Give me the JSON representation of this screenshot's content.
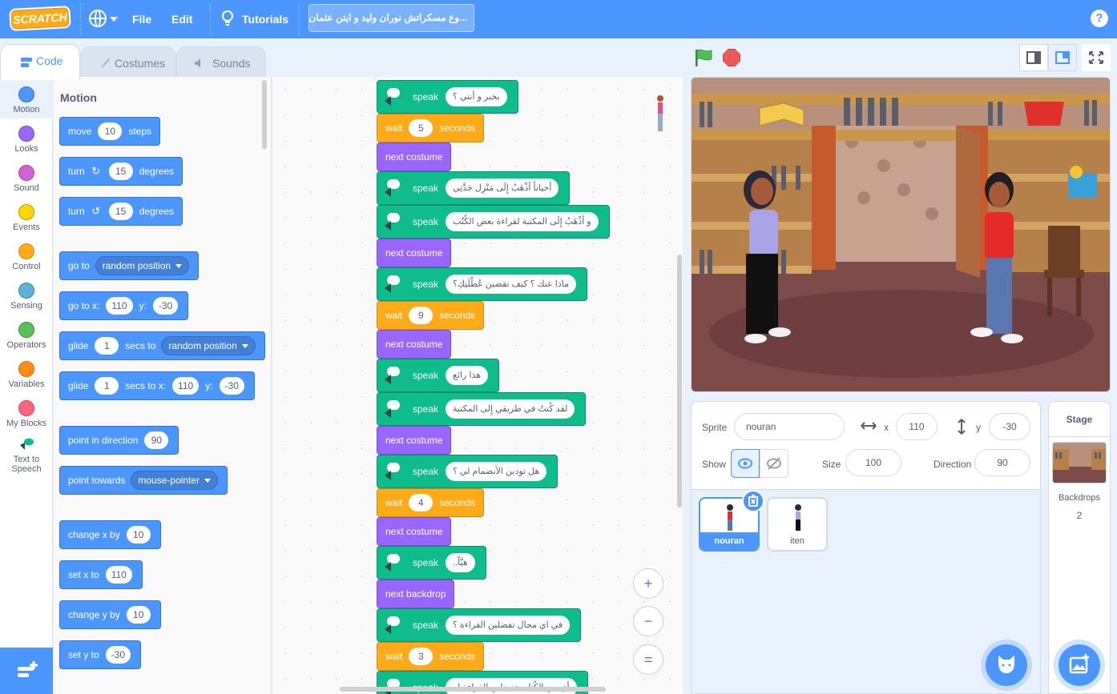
{
  "menubar": {
    "logo": "SCRATCH",
    "file": "File",
    "edit": "Edit",
    "tutorials": "Tutorials",
    "project_title": "...وع مسكراتش نوران وليد و ايتن عثمان",
    "help": "?"
  },
  "tabs": {
    "code": "Code",
    "costumes": "Costumes",
    "sounds": "Sounds"
  },
  "categories": [
    {
      "label": "Motion",
      "color": "#4c97ff"
    },
    {
      "label": "Looks",
      "color": "#9966ff"
    },
    {
      "label": "Sound",
      "color": "#cf63cf"
    },
    {
      "label": "Events",
      "color": "#ffd500"
    },
    {
      "label": "Control",
      "color": "#ffab19"
    },
    {
      "label": "Sensing",
      "color": "#5cb1d6"
    },
    {
      "label": "Operators",
      "color": "#59c059"
    },
    {
      "label": "Variables",
      "color": "#ff8c1a"
    },
    {
      "label": "My Blocks",
      "color": "#ff6680"
    },
    {
      "label": "Text to Speech",
      "color": "#0fbd8c"
    }
  ],
  "palette": {
    "title": "Motion",
    "move": {
      "a": "move",
      "v": "10",
      "b": "steps"
    },
    "turn_cw": {
      "a": "turn",
      "v": "15",
      "b": "degrees"
    },
    "turn_ccw": {
      "a": "turn",
      "v": "15",
      "b": "degrees"
    },
    "goto": {
      "a": "go to",
      "opt": "random position"
    },
    "goto_xy": {
      "a": "go to x:",
      "x": "110",
      "b": "y:",
      "y": "-30"
    },
    "glide": {
      "a": "glide",
      "v": "1",
      "b": "secs to",
      "opt": "random position"
    },
    "glide_xy": {
      "a": "glide",
      "v": "1",
      "b": "secs to x:",
      "x": "110",
      "c": "y:",
      "y": "-30"
    },
    "point_dir": {
      "a": "point in direction",
      "v": "90"
    },
    "point_towards": {
      "a": "point towards",
      "opt": "mouse-pointer"
    },
    "change_x": {
      "a": "change x by",
      "v": "10"
    },
    "set_x": {
      "a": "set x to",
      "v": "110"
    },
    "change_y": {
      "a": "change y by",
      "v": "10"
    },
    "set_y": {
      "a": "set y to",
      "v": "-30"
    }
  },
  "script": [
    {
      "type": "speak",
      "label": "speak",
      "text": "بخير و أنتي ؟"
    },
    {
      "type": "wait",
      "label": "wait",
      "value": "5",
      "suffix": "seconds"
    },
    {
      "type": "costume",
      "label": "next costume"
    },
    {
      "type": "speak",
      "label": "speak",
      "text": "أحياناً أذْهَبُ إِلَى مَنْزِل جَدَّتِي"
    },
    {
      "type": "speak",
      "label": "speak",
      "text": "و أذْهَبُ إِلَى المكتبة لقراءة بعض الكُتُب"
    },
    {
      "type": "costume",
      "label": "next costume"
    },
    {
      "type": "speak",
      "label": "speak",
      "text": "ماذا عنك ؟ كيف تقضين عُطْلَتِكِ؟"
    },
    {
      "type": "wait",
      "label": "wait",
      "value": "9",
      "suffix": "seconds"
    },
    {
      "type": "costume",
      "label": "next costume"
    },
    {
      "type": "speak",
      "label": "speak",
      "text": "هذا رائع"
    },
    {
      "type": "speak",
      "label": "speak",
      "text": "لقد كُنتُ في طريقي إِلى المكتبة"
    },
    {
      "type": "costume",
      "label": "next costume"
    },
    {
      "type": "speak",
      "label": "speak",
      "text": "هل تودين الأنضمام لي ؟"
    },
    {
      "type": "wait",
      "label": "wait",
      "value": "4",
      "suffix": "seconds"
    },
    {
      "type": "costume",
      "label": "next costume"
    },
    {
      "type": "speak",
      "label": "speak",
      "text": "هيَّاً.."
    },
    {
      "type": "backdrop",
      "label": "next backdrop"
    },
    {
      "type": "speak",
      "label": "speak",
      "text": "في اي مجال تفضلين القراءة ؟"
    },
    {
      "type": "wait",
      "label": "wait",
      "value": "3",
      "suffix": "seconds"
    },
    {
      "type": "speak",
      "label": "speak",
      "text": "أي من الكُتاب تفضلين القراءة له"
    }
  ],
  "zoom": {
    "in": "+",
    "out": "−",
    "reset": "="
  },
  "sprite_info": {
    "sprite_label": "Sprite",
    "sprite_name": "nouran",
    "x_label": "x",
    "x": "110",
    "y_label": "y",
    "y": "-30",
    "show_label": "Show",
    "size_label": "Size",
    "size": "100",
    "direction_label": "Direction",
    "direction": "90"
  },
  "sprites": [
    {
      "name": "nouran",
      "selected": true
    },
    {
      "name": "iten",
      "selected": false
    }
  ],
  "stage_selector": {
    "title": "Stage",
    "backdrops_label": "Backdrops",
    "backdrops_count": "2"
  },
  "colors": {
    "accent": "#4c97ff",
    "motion": "#4c97ff",
    "looks": "#9966ff",
    "control": "#ffab19",
    "tts": "#0fbd8c"
  }
}
